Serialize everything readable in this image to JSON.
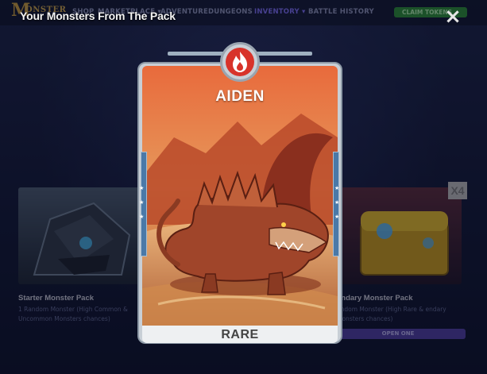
{
  "nav": {
    "logo_initial": "M",
    "logo_rest": "ONSTER",
    "items": [
      {
        "label": "SHOP"
      },
      {
        "label": "MARKETPLACE ▾"
      },
      {
        "label": "ADVENTURE"
      },
      {
        "label": "DUNGEONS"
      },
      {
        "label": "INVENTORY ▾"
      },
      {
        "label": "BATTLE HISTORY"
      }
    ],
    "claim_label": "CLAIM TOKENS",
    "active_item": "INVENTORY",
    "accent_color": "#7a6cf0",
    "claim_color": "#2a8a36"
  },
  "modal": {
    "title": "Your Monsters From The Pack",
    "close_icon": "×"
  },
  "packs": [
    {
      "name": "Starter Monster Pack",
      "description": "1 Random Monster (High Common & Uncommon Monsters chances)"
    },
    {
      "name": "endary Monster Pack",
      "description": "andom Monster (High Rare & endary Monsters chances)",
      "badge": "X4",
      "button_label": "OPEN ONE"
    }
  ],
  "card": {
    "name": "AIDEN",
    "rarity": "RARE",
    "element_icon": "fire-icon",
    "element_color": "#d8332a"
  }
}
